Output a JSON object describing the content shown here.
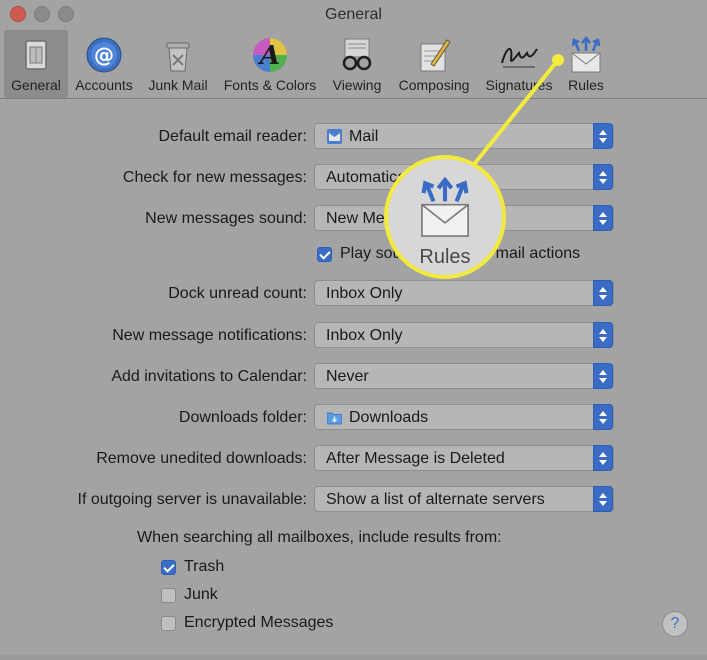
{
  "window": {
    "title": "General"
  },
  "toolbar": {
    "tabs": [
      {
        "label": "General",
        "icon": "general-icon",
        "selected": true
      },
      {
        "label": "Accounts",
        "icon": "at-icon",
        "selected": false
      },
      {
        "label": "Junk Mail",
        "icon": "trash-bin-icon",
        "selected": false
      },
      {
        "label": "Fonts & Colors",
        "icon": "font-color-icon",
        "selected": false
      },
      {
        "label": "Viewing",
        "icon": "glasses-icon",
        "selected": false
      },
      {
        "label": "Composing",
        "icon": "pencil-note-icon",
        "selected": false
      },
      {
        "label": "Signatures",
        "icon": "signature-icon",
        "selected": false
      },
      {
        "label": "Rules",
        "icon": "rules-envelope-icon",
        "selected": false
      }
    ]
  },
  "settings": {
    "default_reader": {
      "label": "Default email reader:",
      "value": "Mail"
    },
    "check_new": {
      "label": "Check for new messages:",
      "value": "Automatically"
    },
    "new_sound": {
      "label": "New messages sound:",
      "value": "New Messages Sound"
    },
    "play_sounds": {
      "label": "Play sounds for other mail actions",
      "checked": true
    },
    "dock_unread": {
      "label": "Dock unread count:",
      "value": "Inbox Only"
    },
    "notifications": {
      "label": "New message notifications:",
      "value": "Inbox Only"
    },
    "invitations": {
      "label": "Add invitations to Calendar:",
      "value": "Never"
    },
    "downloads_folder": {
      "label": "Downloads folder:",
      "value": "Downloads"
    },
    "remove_downloads": {
      "label": "Remove unedited downloads:",
      "value": "After Message is Deleted"
    },
    "outgoing_server": {
      "label": "If outgoing server is unavailable:",
      "value": "Show a list of alternate servers"
    }
  },
  "search": {
    "heading": "When searching all mailboxes, include results from:",
    "options": [
      {
        "label": "Trash",
        "checked": true
      },
      {
        "label": "Junk",
        "checked": false
      },
      {
        "label": "Encrypted Messages",
        "checked": false
      }
    ]
  },
  "help": {
    "label": "?"
  },
  "callout": {
    "label": "Rules",
    "color": "#f2ea3c"
  },
  "colors": {
    "accent": "#3a6cc6",
    "close": "#d05b52"
  }
}
